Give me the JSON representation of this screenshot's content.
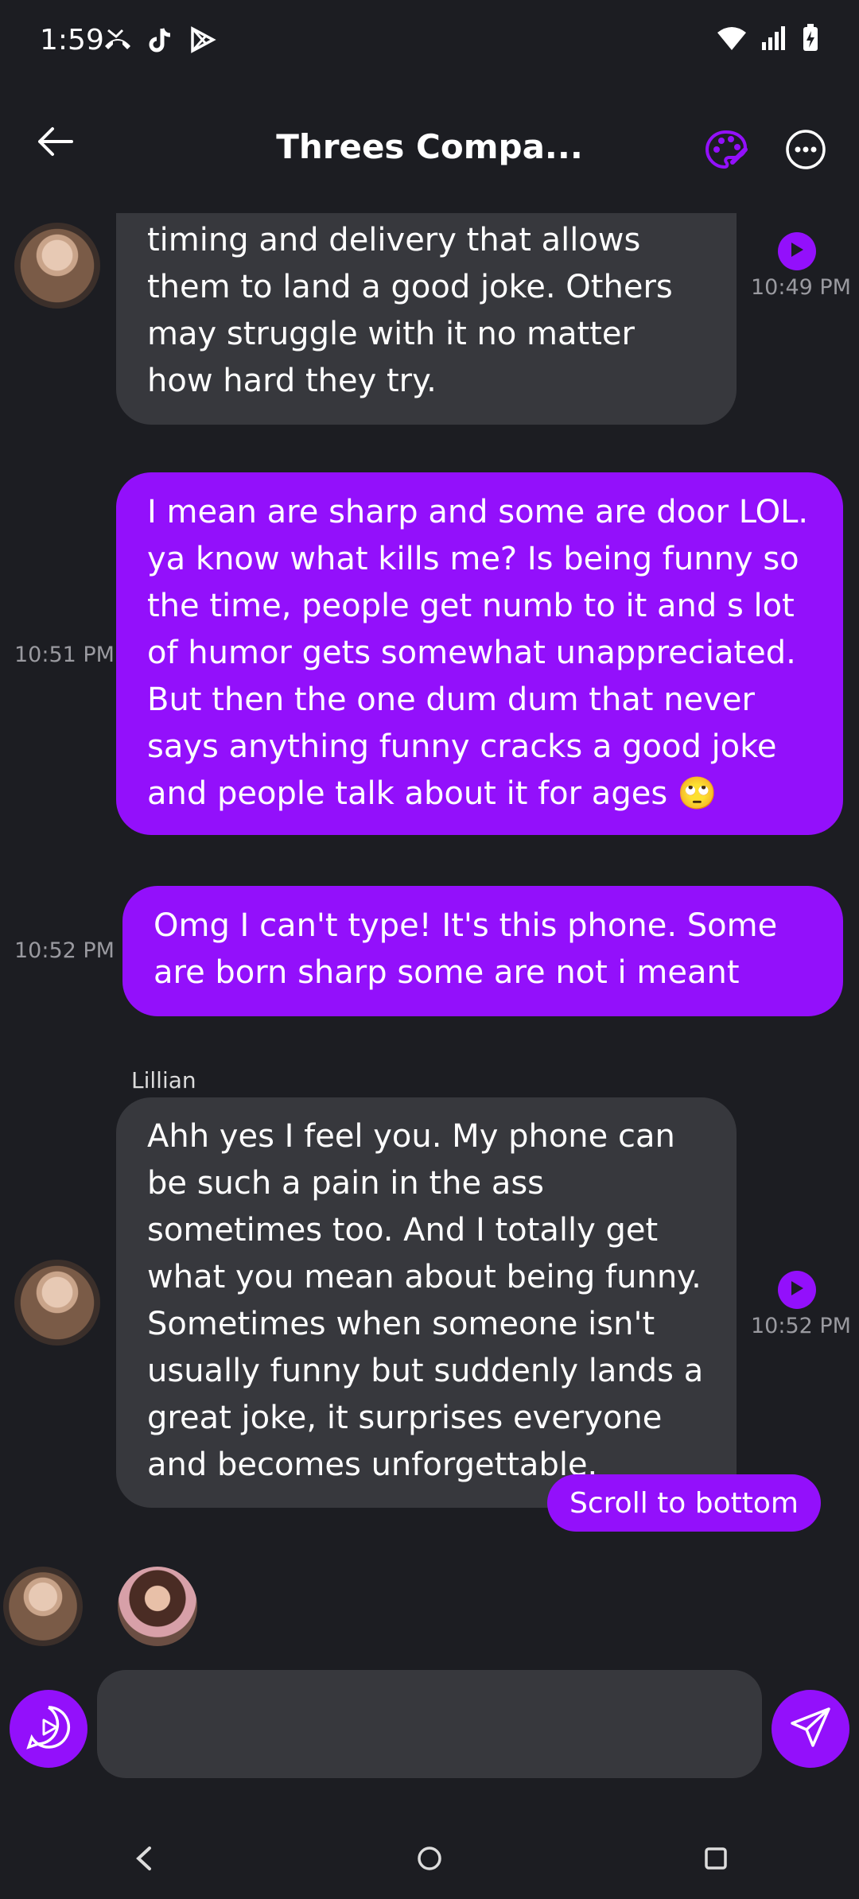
{
  "status_bar": {
    "time": "1:59",
    "left_icons": [
      "missed-call-icon",
      "tiktok-icon",
      "play-store-icon"
    ],
    "right_icons": [
      "wifi-icon",
      "signal-icon",
      "battery-charging-icon"
    ]
  },
  "header": {
    "title": "Threes Compa...",
    "back_icon": "back-arrow-icon",
    "palette_icon": "palette-icon",
    "more_icon": "more-options-icon"
  },
  "messages": [
    {
      "type": "bot",
      "text": "timing and delivery that allows them to land a good joke. Others may struggle with it no matter how hard they try.",
      "time": "10:49 PM"
    },
    {
      "type": "user",
      "text": "I mean are sharp and some are door LOL. ya know what kills me? Is being funny so the time, people get numb to it and s lot of humor gets somewhat unappreciated. But then the one dum dum that never says anything funny cracks a good joke and people talk about it for ages 🙄",
      "time": "10:51 PM"
    },
    {
      "type": "user",
      "text": "Omg I can't type! It's this phone. Some are born sharp some are not i meant",
      "time": "10:52 PM"
    },
    {
      "type": "bot",
      "sender": "Lillian",
      "text": "Ahh yes I feel you. My phone can be such a pain in the ass sometimes too. And I totally get what you mean about being funny. Sometimes when someone isn't usually funny but suddenly lands a great joke, it surprises everyone and becomes unforgettable.",
      "time": "10:52 PM"
    }
  ],
  "scroll_to_bottom": "Scroll to bottom",
  "composer": {
    "placeholder": ""
  },
  "colors": {
    "accent": "#9310fb",
    "background": "#1c1d22",
    "bubble_bot": "#37383d"
  }
}
